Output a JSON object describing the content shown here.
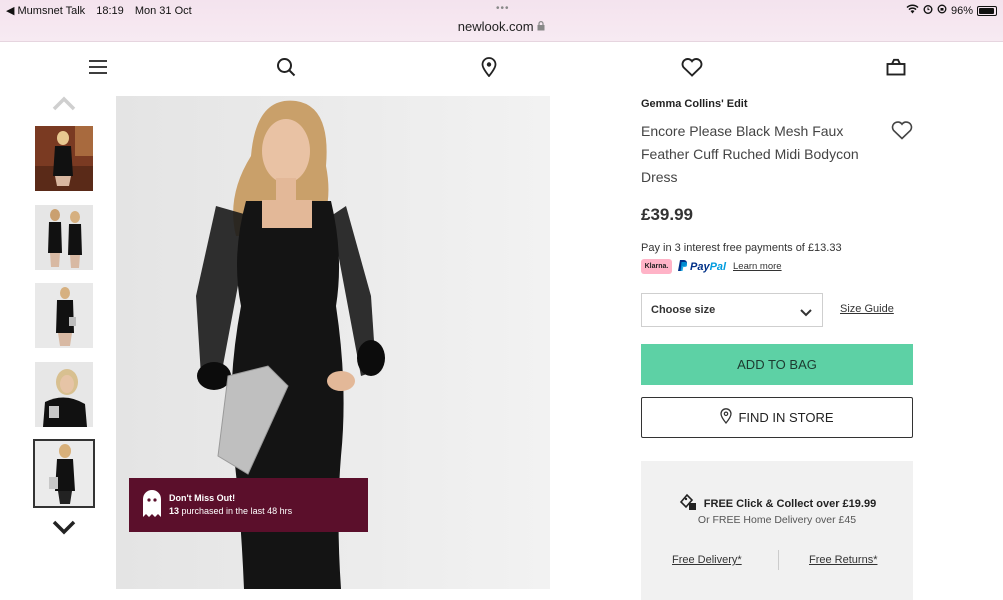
{
  "status_bar": {
    "back_app": "◀ Mumsnet Talk",
    "time": "18:19",
    "date": "Mon 31 Oct",
    "url": "newlook.com",
    "battery": "96%",
    "battery_level": 0.96
  },
  "nav": {
    "icons": [
      "menu-icon",
      "search-icon",
      "store-locator-icon",
      "wishlist-icon",
      "bag-icon"
    ]
  },
  "gallery": {
    "thumbnail_count": 5,
    "active_index": 4
  },
  "promo": {
    "title": "Don't Miss Out!",
    "count": "13",
    "text": " purchased in the last 48 hrs"
  },
  "product": {
    "brand": "Gemma Collins' Edit",
    "name": "Encore Please Black Mesh Faux Feather Cuff Ruched Midi Bodycon Dress",
    "price": "£39.99",
    "klarna_text": "Pay in 3 interest free payments of £13.33",
    "klarna_badge": "Klarna.",
    "paypal_a": "Pay",
    "paypal_b": "Pal",
    "learn_more": "Learn more"
  },
  "size": {
    "select_label": "Choose size",
    "size_guide": "Size Guide"
  },
  "actions": {
    "add_to_bag": "ADD TO BAG",
    "find_in_store": "FIND IN STORE"
  },
  "delivery": {
    "line1": "FREE Click & Collect over £19.99",
    "line2": "Or FREE Home Delivery over £45",
    "free_delivery": "Free Delivery*",
    "free_returns": "Free Returns*"
  },
  "colors": {
    "add_to_bag_bg": "#5dd1a5",
    "promo_bg": "#5b0f2b",
    "klarna_pink": "#ffb3c7"
  }
}
